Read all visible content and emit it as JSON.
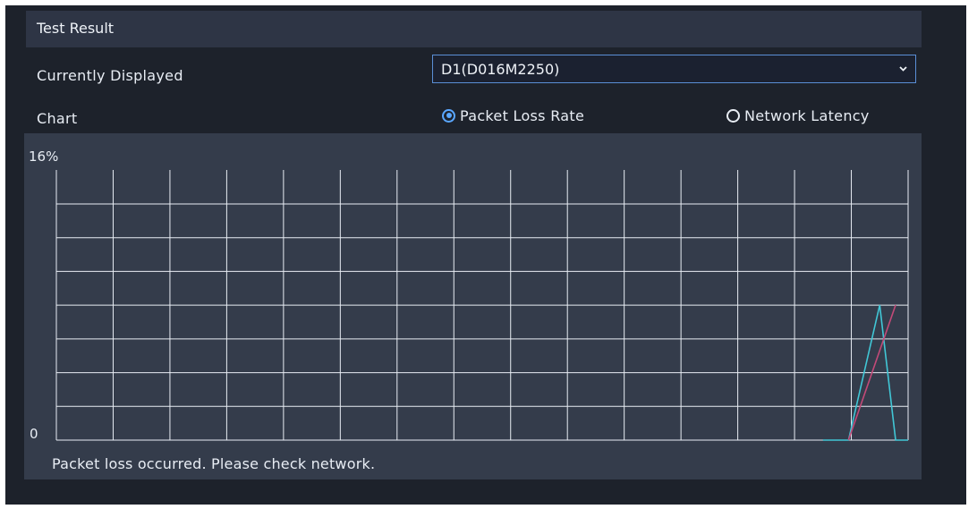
{
  "section": {
    "title": "Test Result"
  },
  "currently_displayed": {
    "label": "Currently Displayed",
    "value": "D1(D016M2250)"
  },
  "chart_row": {
    "label": "Chart",
    "options": [
      {
        "label": "Packet Loss Rate",
        "selected": true
      },
      {
        "label": "Network Latency",
        "selected": false
      }
    ]
  },
  "colors": {
    "accent": "#5aa7ff",
    "grid": "#e8edf4",
    "series_cyan": "#41c7d6",
    "series_pink": "#c24a78"
  },
  "chart_data": {
    "type": "line",
    "y_max_label": "16%",
    "y_min_label": "0",
    "ylim": [
      0,
      16
    ],
    "x_divisions": 15,
    "y_divisions": 7,
    "grid": true,
    "series": [
      {
        "color": "#41c7d6",
        "x": [
          13.5,
          13.95,
          14.5,
          14.78,
          15.0
        ],
        "values": [
          0,
          0,
          8.0,
          0,
          0
        ]
      },
      {
        "color": "#c24a78",
        "x": [
          13.95,
          14.78
        ],
        "values": [
          0,
          8.0
        ]
      }
    ]
  },
  "status_message": "Packet loss occurred. Please check network."
}
